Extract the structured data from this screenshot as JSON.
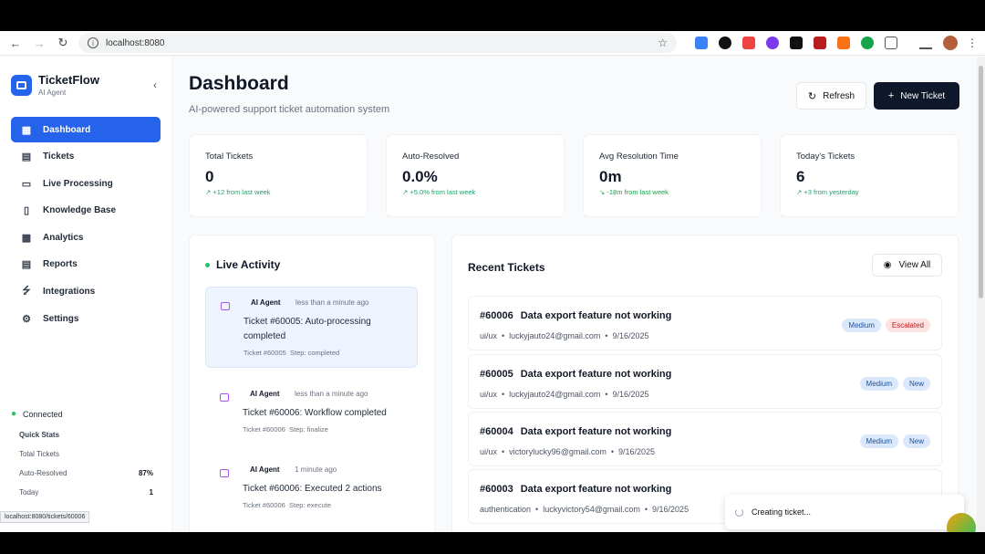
{
  "browser": {
    "url": "localhost:8080"
  },
  "brand": {
    "name": "TicketFlow",
    "subtitle": "AI Agent"
  },
  "nav": [
    {
      "label": "Dashboard",
      "icon": "grid-icon"
    },
    {
      "label": "Tickets",
      "icon": "ticket-icon"
    },
    {
      "label": "Live Processing",
      "icon": "bot-icon"
    },
    {
      "label": "Knowledge Base",
      "icon": "book-icon"
    },
    {
      "label": "Analytics",
      "icon": "chart-icon"
    },
    {
      "label": "Reports",
      "icon": "file-icon"
    },
    {
      "label": "Integrations",
      "icon": "bolt-icon"
    },
    {
      "label": "Settings",
      "icon": "gear-icon"
    }
  ],
  "connection": {
    "label": "Connected"
  },
  "quick_stats": {
    "title": "Quick Stats",
    "rows": [
      {
        "label": "Total Tickets",
        "value": ""
      },
      {
        "label": "Auto-Resolved",
        "value": "87%"
      },
      {
        "label": "Today",
        "value": "1"
      }
    ]
  },
  "status_url": "localhost:8080/tickets/60006",
  "header": {
    "title": "Dashboard",
    "subtitle": "AI-powered support ticket automation system",
    "refresh_label": "Refresh",
    "new_ticket_label": "New Ticket"
  },
  "stats": [
    {
      "label": "Total Tickets",
      "value": "0",
      "delta": "+12 from last week"
    },
    {
      "label": "Auto-Resolved",
      "value": "0.0%",
      "delta": "+5.0% from last week"
    },
    {
      "label": "Avg Resolution Time",
      "value": "0m",
      "delta": "-18m from last week"
    },
    {
      "label": "Today's Tickets",
      "value": "6",
      "delta": "+3 from yesterday"
    }
  ],
  "live_activity": {
    "title": "Live Activity",
    "items": [
      {
        "who": "AI Agent",
        "when": "less than a minute ago",
        "msg": "Ticket #60005: Auto-processing completed",
        "ticket": "Ticket #60005",
        "step": "Step: completed"
      },
      {
        "who": "AI Agent",
        "when": "less than a minute ago",
        "msg": "Ticket #60006: Workflow completed",
        "ticket": "Ticket #60006",
        "step": "Step: finalize"
      },
      {
        "who": "AI Agent",
        "when": "1 minute ago",
        "msg": "Ticket #60006: Executed 2 actions",
        "ticket": "Ticket #60006",
        "step": "Step: execute"
      }
    ]
  },
  "recent_tickets": {
    "title": "Recent Tickets",
    "view_all_label": "View All",
    "items": [
      {
        "id": "#60006",
        "title": "Data export feature not working",
        "category": "ui/ux",
        "email": "luckyjauto24@gmail.com",
        "date": "9/16/2025",
        "priority": "Medium",
        "status": "Escalated"
      },
      {
        "id": "#60005",
        "title": "Data export feature not working",
        "category": "ui/ux",
        "email": "luckyjauto24@gmail.com",
        "date": "9/16/2025",
        "priority": "Medium",
        "status": "New"
      },
      {
        "id": "#60004",
        "title": "Data export feature not working",
        "category": "ui/ux",
        "email": "victorylucky96@gmail.com",
        "date": "9/16/2025",
        "priority": "Medium",
        "status": "New"
      },
      {
        "id": "#60003",
        "title": "Data export feature not working",
        "category": "authentication",
        "email": "luckyvictory54@gmail.com",
        "date": "9/16/2025",
        "priority": "",
        "status": ""
      }
    ]
  },
  "toast": {
    "label": "Creating ticket..."
  },
  "colors": {
    "accent": "#2563eb",
    "dark": "#0f172a",
    "success": "#22c55e",
    "escalated": "#b91c1c"
  }
}
